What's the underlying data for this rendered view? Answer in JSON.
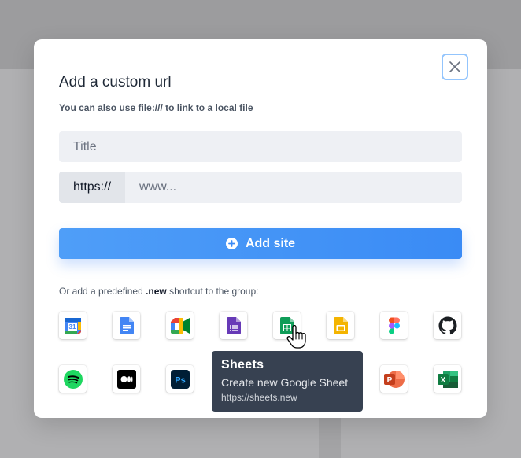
{
  "modal": {
    "title": "Add a custom url",
    "subtitle": "You can also use file:/// to link to a local file",
    "title_placeholder": "Title",
    "url_prefix": "https://",
    "url_placeholder": "www...",
    "add_button_label": "Add site",
    "shortcut_prefix": "Or add a predefined ",
    "shortcut_keyword": ".new",
    "shortcut_suffix": " shortcut to the group:"
  },
  "shortcuts": [
    {
      "name": "calendar-icon"
    },
    {
      "name": "docs-icon"
    },
    {
      "name": "meet-icon"
    },
    {
      "name": "forms-icon"
    },
    {
      "name": "sheets-icon"
    },
    {
      "name": "slides-icon"
    },
    {
      "name": "figma-icon"
    },
    {
      "name": "github-icon"
    },
    {
      "name": "spotify-icon"
    },
    {
      "name": "medium-icon"
    },
    {
      "name": "photoshop-icon"
    },
    {
      "name": "powerpoint-icon"
    },
    {
      "name": "excel-icon"
    }
  ],
  "tooltip": {
    "title": "Sheets",
    "description": "Create new Google Sheet",
    "url": "https://sheets.new"
  },
  "colors": {
    "accent": "#3b8bf6",
    "tooltip_bg": "#374151",
    "close_border": "#93c5fd"
  }
}
